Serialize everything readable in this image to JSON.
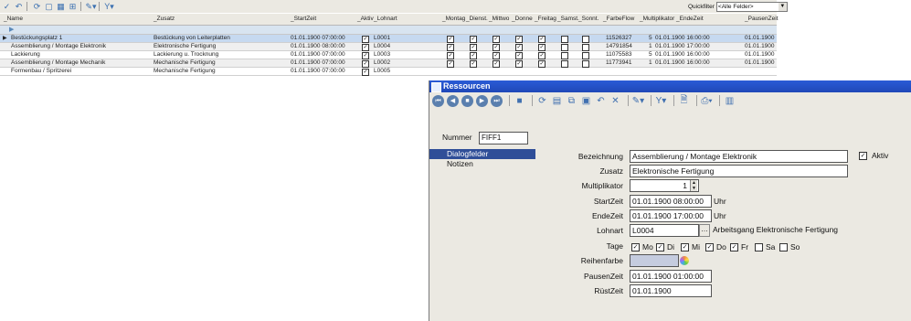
{
  "toolbar": {
    "icons": [
      "check-icon",
      "undo-icon",
      "refresh-icon",
      "new-icon",
      "grid-icon",
      "layout-icon",
      "tools-icon",
      "filter-icon"
    ],
    "quickfilter_label": "Quickfilter",
    "quickfilter_value": "<Alle Felder>"
  },
  "grid": {
    "columns": [
      "_Name",
      "_Zusatz",
      "_StartZeit",
      "_Aktiv",
      "_Lohnart",
      "_Montag",
      "_Dienst.",
      "_Mittwo",
      "_Donne",
      "_Freitag",
      "_Samst.",
      "_Sonnt.",
      "_FarbeFlow",
      "_Multiplikator",
      "_EndeZeit",
      "_PausenZeit"
    ],
    "rows": [
      {
        "name": "Bestückungsplatz 1",
        "zusatz": "Bestückung von Leiterplatten",
        "start": "01.01.1900 07:00:00",
        "lohnart": "L0001",
        "farbe": "11526327",
        "mult": "5",
        "ende": "01.01.1900 16:00:00",
        "pause": "01.01.1900"
      },
      {
        "name": "Assemblierung / Montage Elektronik",
        "zusatz": "Elektronische Fertigung",
        "start": "01.01.1900 08:00:00",
        "lohnart": "L0004",
        "farbe": "14791854",
        "mult": "1",
        "ende": "01.01.1900 17:00:00",
        "pause": "01.01.1900"
      },
      {
        "name": "Lackierung",
        "zusatz": "Lackierung u. Trocknung",
        "start": "01.01.1900 07:00:00",
        "lohnart": "L0003",
        "farbe": "11075583",
        "mult": "5",
        "ende": "01.01.1900 16:00:00",
        "pause": "01.01.1900"
      },
      {
        "name": "Assemblierung / Montage Mechanik",
        "zusatz": "Mechanische Fertigung",
        "start": "01.01.1900 07:00:00",
        "lohnart": "L0002",
        "farbe": "11773941",
        "mult": "1",
        "ende": "01.01.1900 16:00:00",
        "pause": "01.01.1900"
      },
      {
        "name": "Formenbau / Spritzerei",
        "zusatz": "Mechanische Fertigung",
        "start": "01.01.1900 07:00:00",
        "lohnart": "L0005",
        "farbe": "",
        "mult": "",
        "ende": "",
        "pause": ""
      }
    ]
  },
  "dialog": {
    "title": "Ressourcen",
    "nummer_label": "Nummer",
    "nummer_value": "FIFF1",
    "nav": [
      "Dialogfelder",
      "Notizen"
    ],
    "labels": {
      "bezeichnung": "Bezeichnung",
      "zusatz": "Zusatz",
      "multiplikator": "Multiplikator",
      "startzeit": "StartZeit",
      "endezeit": "EndeZeit",
      "lohnart": "Lohnart",
      "tage": "Tage",
      "reihenfarbe": "Reihenfarbe",
      "pausenzeit": "PausenZeit",
      "ruestzeit": "RüstZeit",
      "aktiv": "Aktiv",
      "uhr": "Uhr"
    },
    "values": {
      "bezeichnung": "Assemblierung / Montage Elektronik",
      "zusatz": "Elektronische Fertigung",
      "multiplikator": "1",
      "startzeit": "01.01.1900 08:00:00",
      "endezeit": "01.01.1900 17:00:00",
      "lohnart": "L0004",
      "lohnart_desc": "Arbeitsgang Elektronische Fertigung",
      "pausenzeit": "01.01.1900 01:00:00",
      "ruestzeit": "01.01.1900"
    },
    "days": [
      {
        "label": "Mo",
        "checked": "✓"
      },
      {
        "label": "Di",
        "checked": "✓"
      },
      {
        "label": "Mi",
        "checked": "✓"
      },
      {
        "label": "Do",
        "checked": "✓"
      },
      {
        "label": "Fr",
        "checked": "✓"
      },
      {
        "label": "Sa",
        "checked": ""
      },
      {
        "label": "So",
        "checked": ""
      }
    ],
    "aktiv_checked": "✓",
    "reihenfarbe_color": "#c5ccdf"
  }
}
